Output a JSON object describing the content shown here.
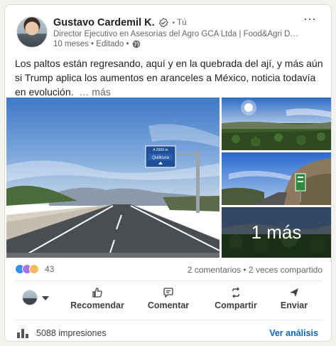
{
  "post": {
    "author": {
      "name": "Gustavo Cardemil K.",
      "connection": "Tú",
      "headline": "Director Ejecutivo en Asesorías del Agro GCA Ltda | Food&Agri Deud...",
      "meta": "10 meses • Editado •"
    },
    "text": "Los paltos están regresando, aquí y en la quebrada del ají, y más aún si Trump aplica los aumentos en aranceles a México, noticia todavía en evolución.",
    "see_more": "… más",
    "images": {
      "more_overlay": "1 más",
      "road_sign_top": "A 2000 m",
      "road_sign_main": "Quilicura"
    },
    "social": {
      "reaction_count": "43",
      "comments_shares": "2 comentarios • 2 veces compartido"
    },
    "actions": {
      "like": "Recomendar",
      "comment": "Comentar",
      "share": "Compartir",
      "send": "Enviar"
    },
    "footer": {
      "impressions": "5088 impresiones",
      "analytics": "Ver análisis"
    }
  },
  "colors": {
    "link_blue": "#0a66c2",
    "muted_text": "#666666",
    "sign_blue": "#1f4f96"
  }
}
